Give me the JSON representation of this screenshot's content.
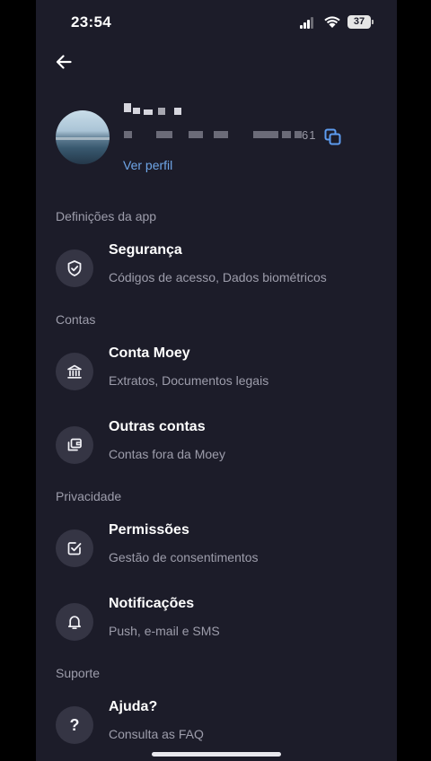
{
  "status_bar": {
    "time": "23:54",
    "battery": "37"
  },
  "profile": {
    "account_suffix": "61",
    "view_profile_label": "Ver perfil"
  },
  "sections": {
    "app_settings": "Definições da app",
    "accounts": "Contas",
    "privacy": "Privacidade",
    "support": "Suporte"
  },
  "items": {
    "security": {
      "title": "Segurança",
      "subtitle": "Códigos de acesso, Dados biométricos",
      "icon": "shield-check-icon"
    },
    "moey_account": {
      "title": "Conta Moey",
      "subtitle": "Extratos, Documentos legais",
      "icon": "bank-icon"
    },
    "other_accounts": {
      "title": "Outras contas",
      "subtitle": "Contas fora da Moey",
      "icon": "wallet-cards-icon"
    },
    "permissions": {
      "title": "Permissões",
      "subtitle": "Gestão de consentimentos",
      "icon": "checkbox-icon"
    },
    "notifications": {
      "title": "Notificações",
      "subtitle": "Push, e-mail e SMS",
      "icon": "bell-icon"
    },
    "help": {
      "title": "Ajuda?",
      "subtitle": "Consulta as FAQ",
      "icon": "question-icon",
      "glyph": "?"
    }
  },
  "colors": {
    "background": "#1c1c29",
    "icon_circle": "#353544",
    "link": "#6fa6e8",
    "muted_text": "#9d9dab"
  }
}
